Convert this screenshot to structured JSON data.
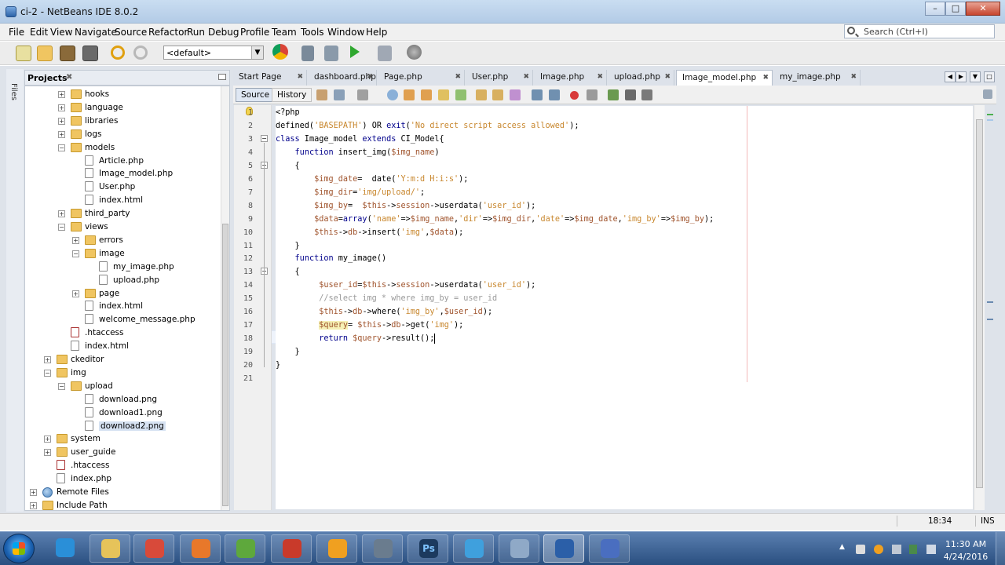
{
  "window": {
    "title": "ci-2 - NetBeans IDE 8.0.2",
    "min": "–",
    "max": "□",
    "close": "✕"
  },
  "menu": [
    "File",
    "Edit",
    "View",
    "Navigate",
    "Source",
    "Refactor",
    "Run",
    "Debug",
    "Profile",
    "Team",
    "Tools",
    "Window",
    "Help"
  ],
  "search": {
    "placeholder": "Search (Ctrl+I)"
  },
  "toolbar": {
    "config": "<default>"
  },
  "projects": {
    "title": "Projects",
    "tab_close": "✖",
    "files_tab": "Files",
    "tree": [
      {
        "label": "hooks",
        "type": "folder",
        "depth": 3,
        "exp": "+"
      },
      {
        "label": "language",
        "type": "folder",
        "depth": 3,
        "exp": "+"
      },
      {
        "label": "libraries",
        "type": "folder",
        "depth": 3,
        "exp": "+"
      },
      {
        "label": "logs",
        "type": "folder",
        "depth": 3,
        "exp": "+"
      },
      {
        "label": "models",
        "type": "folder",
        "depth": 3,
        "exp": "−"
      },
      {
        "label": "Article.php",
        "type": "file",
        "depth": 4,
        "exp": ""
      },
      {
        "label": "Image_model.php",
        "type": "file",
        "depth": 4,
        "exp": ""
      },
      {
        "label": "User.php",
        "type": "file",
        "depth": 4,
        "exp": ""
      },
      {
        "label": "index.html",
        "type": "file",
        "depth": 4,
        "exp": ""
      },
      {
        "label": "third_party",
        "type": "folder",
        "depth": 3,
        "exp": "+"
      },
      {
        "label": "views",
        "type": "folder",
        "depth": 3,
        "exp": "−"
      },
      {
        "label": "errors",
        "type": "folder",
        "depth": 4,
        "exp": "+"
      },
      {
        "label": "image",
        "type": "folder",
        "depth": 4,
        "exp": "−"
      },
      {
        "label": "my_image.php",
        "type": "file",
        "depth": 5,
        "exp": ""
      },
      {
        "label": "upload.php",
        "type": "file",
        "depth": 5,
        "exp": ""
      },
      {
        "label": "page",
        "type": "folder",
        "depth": 4,
        "exp": "+"
      },
      {
        "label": "index.html",
        "type": "file",
        "depth": 4,
        "exp": ""
      },
      {
        "label": "welcome_message.php",
        "type": "file",
        "depth": 4,
        "exp": ""
      },
      {
        "label": ".htaccess",
        "type": "htaccess",
        "depth": 3,
        "exp": ""
      },
      {
        "label": "index.html",
        "type": "file",
        "depth": 3,
        "exp": ""
      },
      {
        "label": "ckeditor",
        "type": "folder",
        "depth": 2,
        "exp": "+"
      },
      {
        "label": "img",
        "type": "folder",
        "depth": 2,
        "exp": "−"
      },
      {
        "label": "upload",
        "type": "folder",
        "depth": 3,
        "exp": "−"
      },
      {
        "label": "download.png",
        "type": "file",
        "depth": 4,
        "exp": ""
      },
      {
        "label": "download1.png",
        "type": "file",
        "depth": 4,
        "exp": ""
      },
      {
        "label": "download2.png",
        "type": "file",
        "depth": 4,
        "exp": "",
        "selected": true
      },
      {
        "label": "system",
        "type": "folder",
        "depth": 2,
        "exp": "+"
      },
      {
        "label": "user_guide",
        "type": "folder",
        "depth": 2,
        "exp": "+"
      },
      {
        "label": ".htaccess",
        "type": "htaccess",
        "depth": 2,
        "exp": ""
      },
      {
        "label": "index.php",
        "type": "file",
        "depth": 2,
        "exp": ""
      },
      {
        "label": "Remote Files",
        "type": "globe",
        "depth": 1,
        "exp": "+"
      },
      {
        "label": "Include Path",
        "type": "folder",
        "depth": 1,
        "exp": "+"
      }
    ]
  },
  "editor_tabs": [
    {
      "label": "Start Page",
      "active": false
    },
    {
      "label": "dashboard.php",
      "active": false
    },
    {
      "label": "Page.php",
      "active": false
    },
    {
      "label": "User.php",
      "active": false
    },
    {
      "label": "Image.php",
      "active": false
    },
    {
      "label": "upload.php",
      "active": false
    },
    {
      "label": "Image_model.php",
      "active": true
    },
    {
      "label": "my_image.php",
      "active": false
    }
  ],
  "editor": {
    "source": "Source",
    "history": "History"
  },
  "code_lines": [
    {
      "n": "1",
      "html": "&lt;?php"
    },
    {
      "n": "2",
      "html": "defined(<span class=\"str\">'BASEPATH'</span>) OR <span class=\"kw\">exit</span>(<span class=\"str\">'No direct script access allowed'</span>);"
    },
    {
      "n": "3",
      "html": "<span class=\"kw\">class</span> Image_model <span class=\"kw\">extends</span> CI_Model{"
    },
    {
      "n": "4",
      "html": "    <span class=\"kw\">function</span> insert_img(<span class=\"var\">$img_name</span>)"
    },
    {
      "n": "5",
      "html": "    {"
    },
    {
      "n": "6",
      "html": "        <span class=\"var\">$img_date</span>=  date(<span class=\"str\">'Y:m:d H:i:s'</span>);"
    },
    {
      "n": "7",
      "html": "        <span class=\"var\">$img_dir</span>=<span class=\"str\">'img/upload/'</span>;"
    },
    {
      "n": "8",
      "html": "        <span class=\"var\">$img_by</span>=  <span class=\"var\">$this</span>-&gt;<span class=\"var\">session</span>-&gt;userdata(<span class=\"str\">'user_id'</span>);"
    },
    {
      "n": "9",
      "html": "        <span class=\"var\">$data</span>=<span class=\"kw\">array</span>(<span class=\"str\">'name'</span>=&gt;<span class=\"var\">$img_name</span>,<span class=\"str\">'dir'</span>=&gt;<span class=\"var\">$img_dir</span>,<span class=\"str\">'date'</span>=&gt;<span class=\"var\">$img_date</span>,<span class=\"str\">'img_by'</span>=&gt;<span class=\"var\">$img_by</span>);"
    },
    {
      "n": "10",
      "html": "        <span class=\"var\">$this</span>-&gt;<span class=\"var\">db</span>-&gt;insert(<span class=\"str\">'img'</span>,<span class=\"var\">$data</span>);"
    },
    {
      "n": "11",
      "html": "    }"
    },
    {
      "n": "12",
      "html": "    <span class=\"kw\">function</span> my_image()"
    },
    {
      "n": "13",
      "html": "    {"
    },
    {
      "n": "14",
      "html": "         <span class=\"var\">$user_id</span>=<span class=\"var\">$this</span>-&gt;<span class=\"var\">session</span>-&gt;userdata(<span class=\"str\">'user_id'</span>);"
    },
    {
      "n": "15",
      "html": "         <span class=\"com\">//select img * where img_by = user_id</span>"
    },
    {
      "n": "16",
      "html": "         <span class=\"var\">$this</span>-&gt;<span class=\"var\">db</span>-&gt;where(<span class=\"str\">'img_by'</span>,<span class=\"var\">$user_id</span>);"
    },
    {
      "n": "17",
      "html": "         <span class=\"var hl\">$query</span>= <span class=\"var\">$this</span>-&gt;<span class=\"var\">db</span>-&gt;get(<span class=\"str\">'img'</span>);"
    },
    {
      "n": "18",
      "html": "         <span class=\"kw\">return</span> <span class=\"var\">$query</span>-&gt;result();<span class=\"caret\"></span>"
    },
    {
      "n": "19",
      "html": "    }"
    },
    {
      "n": "20",
      "html": "}"
    },
    {
      "n": "21",
      "html": ""
    }
  ],
  "status": {
    "position": "18:34",
    "mode": "INS"
  },
  "clock": {
    "time": "11:30 AM",
    "date": "4/24/2016"
  },
  "taskbar_icons": [
    {
      "name": "ie-icon",
      "color": "#2a8fd8"
    },
    {
      "name": "explorer-icon",
      "color": "#e6c35a"
    },
    {
      "name": "chrome-icon",
      "color": "#d84a3a"
    },
    {
      "name": "firefox-icon",
      "color": "#e8782a"
    },
    {
      "name": "vlc-green-icon",
      "color": "#5ea83c"
    },
    {
      "name": "filezilla-icon",
      "color": "#c93a2a"
    },
    {
      "name": "media-icon",
      "color": "#f0a020"
    },
    {
      "name": "package-icon",
      "color": "#6a7c8e"
    },
    {
      "name": "photoshop-icon",
      "color": "#1c3a5e",
      "text": "Ps"
    },
    {
      "name": "telegram-icon",
      "color": "#3fa0dd"
    },
    {
      "name": "virtualbox-icon",
      "color": "#8fa9c7"
    },
    {
      "name": "netbeans-icon",
      "color": "#2b5fa8"
    },
    {
      "name": "vs-icon",
      "color": "#4a6ec0"
    }
  ]
}
